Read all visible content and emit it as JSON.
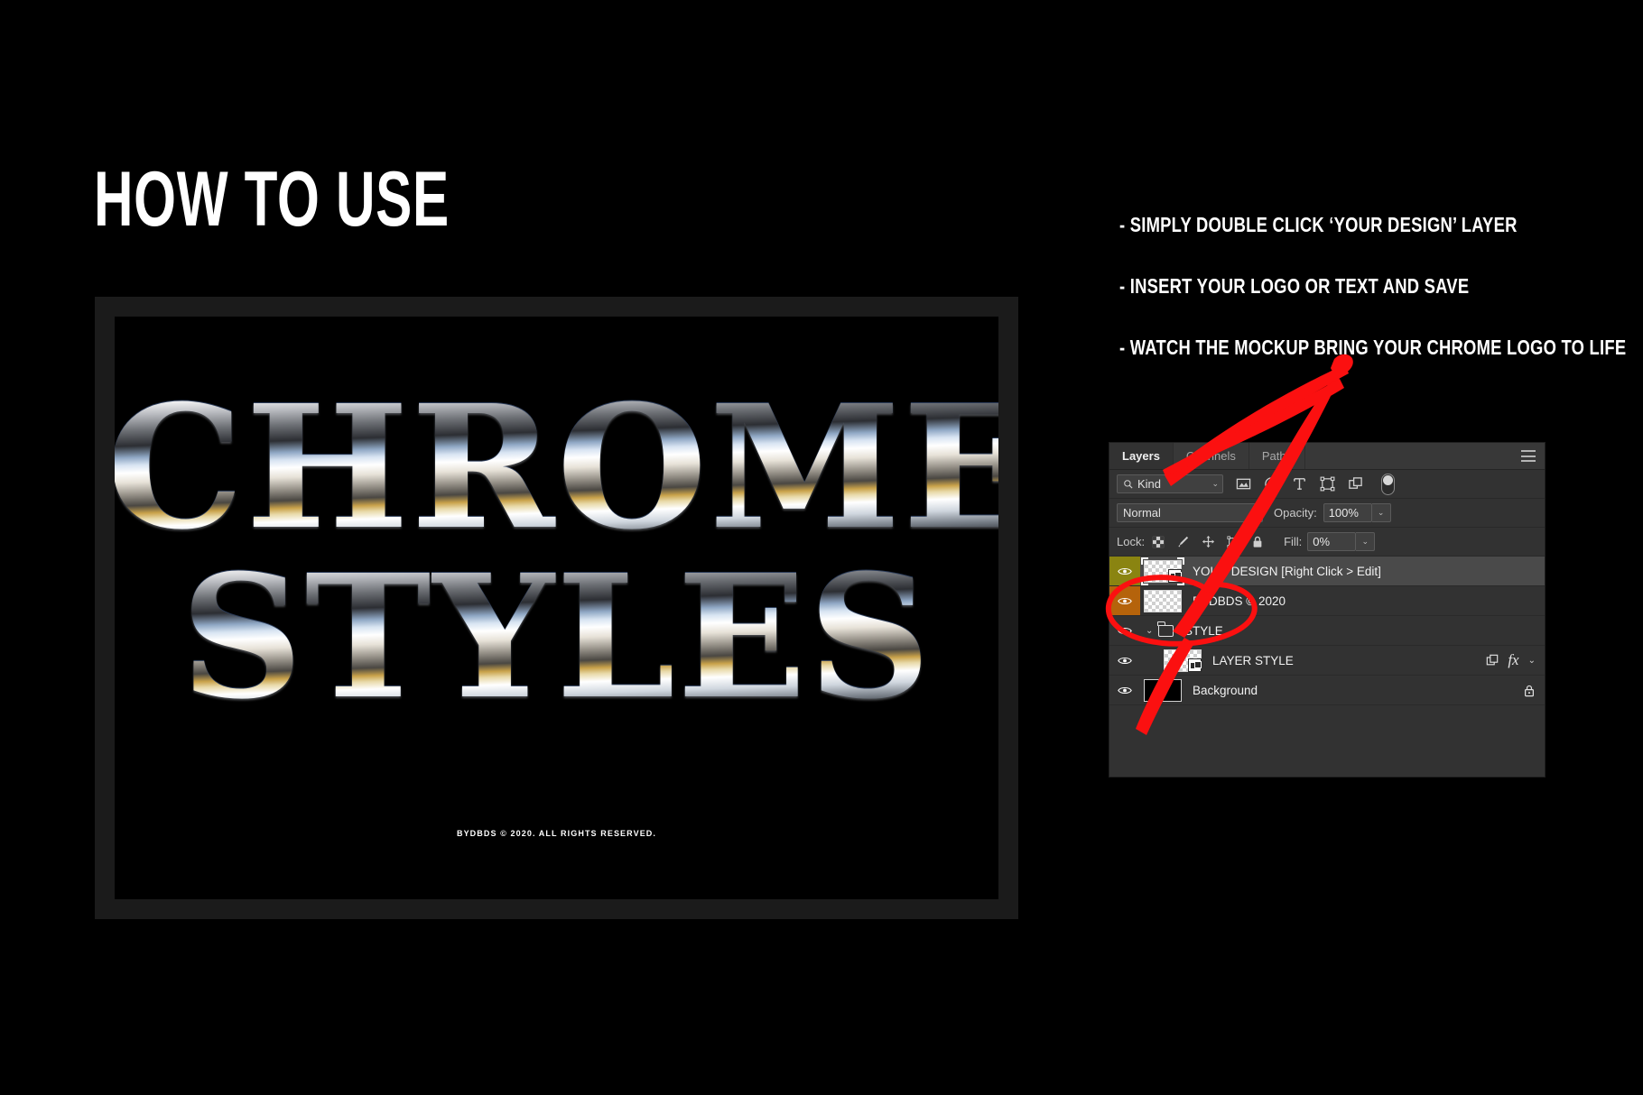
{
  "page": {
    "headline": "HOW TO USE",
    "background_color": "#000000",
    "accent_color": "#ff1111"
  },
  "artboard": {
    "frame_color": "#1b1b1b",
    "canvas_color": "#000000",
    "chrome_text_line1": "CHROME",
    "chrome_text_line2": "STYLES",
    "credit": "BYDBDS © 2020. ALL RIGHTS RESERVED."
  },
  "instructions": {
    "items": [
      "- SIMPLY DOUBLE CLICK ‘YOUR DESIGN’ LAYER",
      "- INSERT YOUR LOGO OR TEXT AND SAVE",
      "- WATCH THE MOCKUP BRING YOUR CHROME LOGO TO LIFE"
    ]
  },
  "layers_panel": {
    "tabs": [
      {
        "label": "Layers",
        "active": true
      },
      {
        "label": "Channels",
        "active": false
      },
      {
        "label": "Paths",
        "active": false
      }
    ],
    "menu_icon": "hamburger-menu-icon",
    "filter": {
      "kind_label": "Kind",
      "search_icon": "magnifier-icon",
      "caret": "⌄",
      "icons": [
        "pixel-layer-filter-icon",
        "adjustment-layer-filter-icon",
        "type-layer-filter-icon",
        "shape-layer-filter-icon",
        "smart-object-filter-icon"
      ],
      "toggle": "filter-enable-toggle"
    },
    "blend": {
      "mode": "Normal",
      "caret": "⌄",
      "opacity_label": "Opacity:",
      "opacity_value": "100%",
      "opacity_caret": "⌄"
    },
    "lock": {
      "label": "Lock:",
      "icons": [
        "lock-transparent-pixels-icon",
        "lock-image-pixels-icon",
        "lock-position-icon",
        "lock-artboard-nesting-icon",
        "lock-all-icon"
      ],
      "fill_label": "Fill:",
      "fill_value": "0%",
      "fill_caret": "⌄"
    },
    "rows": [
      {
        "name": "YOUR DESIGN [Right Click > Edit]",
        "selected": true,
        "color_label": "#8a8411",
        "visible": true,
        "thumb": "smart-object-transparent",
        "indent": 0,
        "highlighted": true
      },
      {
        "name": "BYDBDS © 2020",
        "selected": false,
        "color_label": "#b5630b",
        "visible": true,
        "thumb": "transparent",
        "indent": 0,
        "highlighted": false
      },
      {
        "name": "STYLE",
        "selected": false,
        "color_label": "none",
        "visible": true,
        "thumb": "folder",
        "indent": 0,
        "group_caret": "⌄",
        "highlighted": false
      },
      {
        "name": "LAYER STYLE",
        "selected": false,
        "color_label": "none",
        "visible": true,
        "thumb": "smart-object-transparent",
        "indent": 1,
        "fx": "fx",
        "fx_caret": "⌄",
        "highlighted": false
      },
      {
        "name": "Background",
        "selected": false,
        "color_label": "none",
        "visible": true,
        "thumb": "solid-black",
        "indent": 0,
        "locked": true,
        "highlighted": false
      }
    ]
  },
  "annotations": {
    "arrow": "red-hand-drawn-arrow",
    "ellipse": "red-hand-drawn-ellipse"
  }
}
